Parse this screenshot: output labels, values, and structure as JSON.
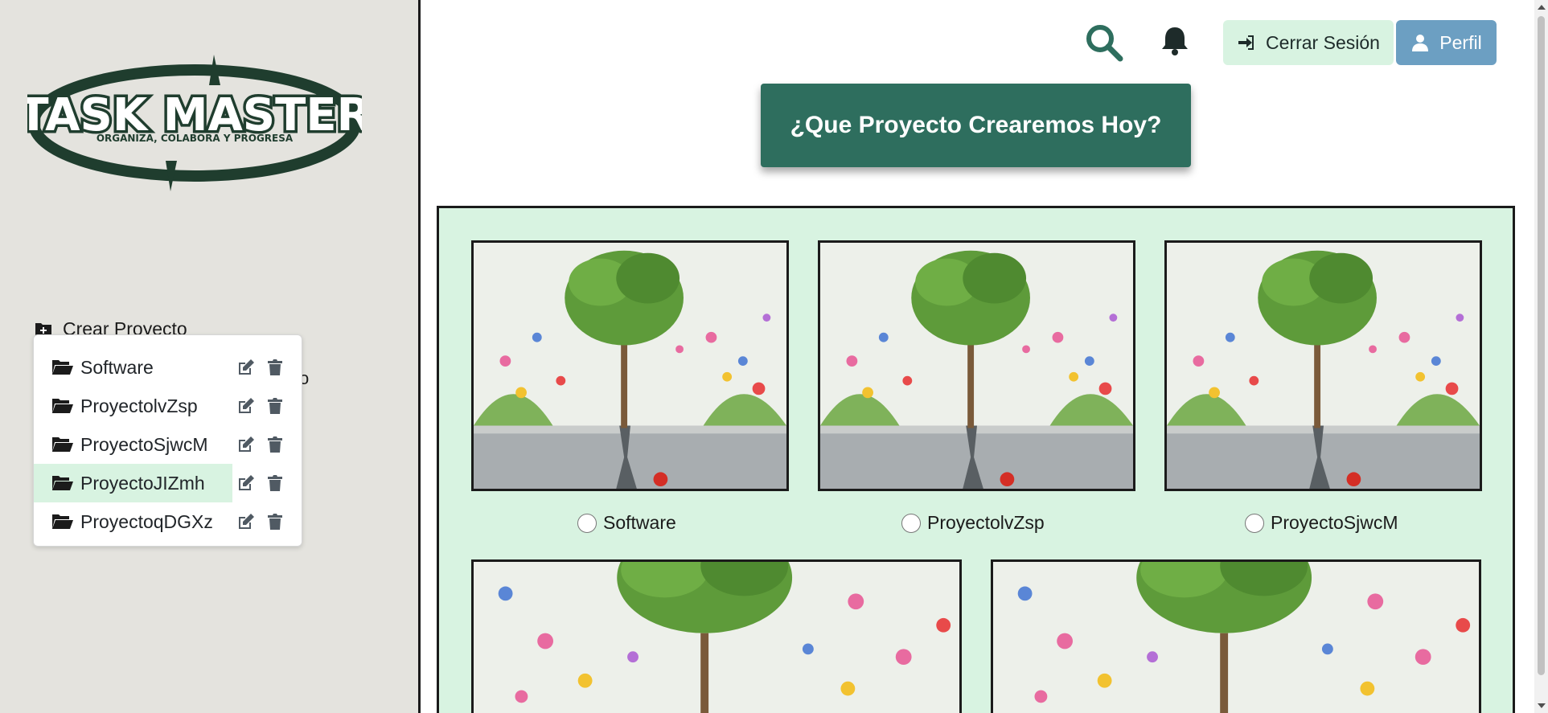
{
  "sidebar": {
    "logo_title": "TASK MASTER",
    "logo_tagline": "ORGANIZA, COLABORA Y PROGRESA",
    "crear_label": "Crear Proyecto",
    "partial_text": "o",
    "projects": [
      {
        "name": "Software",
        "icon": "folder-open-icon"
      },
      {
        "name": "ProyectolvZsp",
        "icon": "folder-open-icon"
      },
      {
        "name": "ProyectoSjwcM",
        "icon": "folder-open-icon"
      },
      {
        "name": "ProyectoJIZmh",
        "icon": "folder-open-icon"
      },
      {
        "name": "ProyectoqDGXz",
        "icon": "folder-open-icon"
      }
    ],
    "active_index": 3
  },
  "header": {
    "logout_label": "Cerrar Sesión",
    "perfil_label": "Perfil",
    "search_icon": "search-icon",
    "bell_icon": "bell-icon"
  },
  "hero": {
    "title": "¿Que Proyecto Crearemos Hoy?"
  },
  "cards": [
    {
      "label": "Software"
    },
    {
      "label": "ProyectolvZsp"
    },
    {
      "label": "ProyectoSjwcM"
    },
    {
      "label": ""
    },
    {
      "label": ""
    }
  ],
  "colors": {
    "accent": "#2e6e5e",
    "mint": "#d8f3e1",
    "perfil": "#6c9fc2",
    "sidebar_bg": "#e4e3de"
  }
}
